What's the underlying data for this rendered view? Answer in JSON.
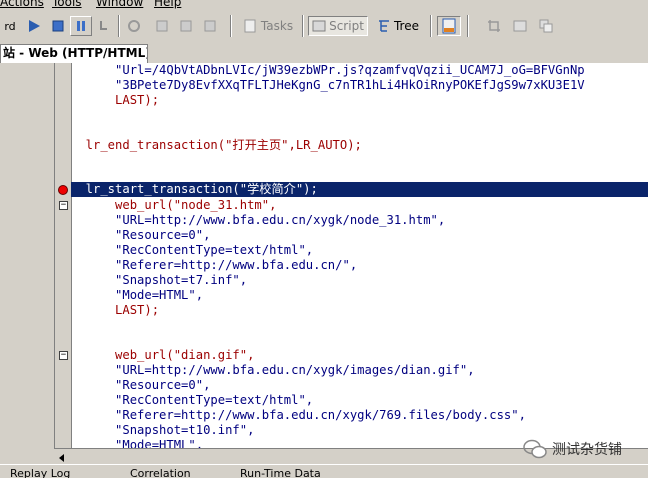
{
  "menu": [
    "Actions",
    "Tools",
    "Window",
    "Help"
  ],
  "toolbar": {
    "tasks_label": "Tasks",
    "script_label": "Script",
    "tree_label": "Tree"
  },
  "tab": {
    "title": "站 - Web (HTTP/HTML)"
  },
  "code_lines": [
    "      \"Url=/4QbVtADbnLVIc/jW39ezbWPr.js?qzamfvqVqzii_UCAM7J_oG=BFVGnNp",
    "      \"3BPete7Dy8EvfXXqTFLTJHeKgnG_c7nTR1hLi4HkOiRnyPOKEfJgS9w7xKU3E1V",
    "      LAST);",
    "",
    "",
    "  lr_end_transaction(\"打开主页\",LR_AUTO);",
    "",
    "",
    "  lr_start_transaction(\"学校简介\");",
    "      web_url(\"node_31.htm\",",
    "      \"URL=http://www.bfa.edu.cn/xygk/node_31.htm\",",
    "      \"Resource=0\",",
    "      \"RecContentType=text/html\",",
    "      \"Referer=http://www.bfa.edu.cn/\",",
    "      \"Snapshot=t7.inf\",",
    "      \"Mode=HTML\",",
    "      LAST);",
    "",
    "",
    "      web_url(\"dian.gif\",",
    "      \"URL=http://www.bfa.edu.cn/xygk/images/dian.gif\",",
    "      \"Resource=0\",",
    "      \"RecContentType=text/html\",",
    "      \"Referer=http://www.bfa.edu.cn/xygk/769.files/body.css\",",
    "      \"Snapshot=t10.inf\",",
    "      \"Mode=HTML\","
  ],
  "bottom_tabs": [
    "Replay Log",
    "Correlation",
    "Run-Time Data"
  ],
  "watermark": "测试杂货铺",
  "colors": {
    "selection": "#0a246a",
    "breakpoint": "#e00000"
  }
}
